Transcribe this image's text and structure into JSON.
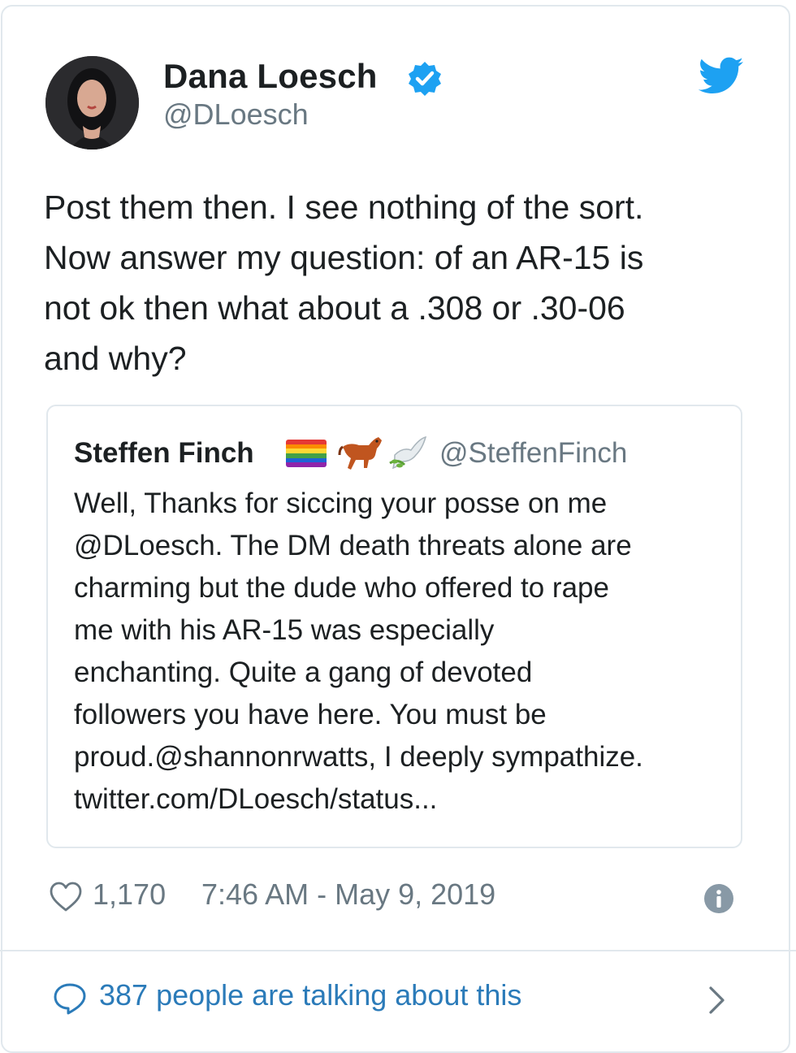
{
  "author": {
    "name": "Dana Loesch",
    "handle": "@DLoesch",
    "verified_icon": "verified-badge-icon",
    "avatar_icon": "avatar"
  },
  "platform_icon": "twitter-bird-icon",
  "tweet_text": "Post them then. I see nothing of the sort.\nNow answer my question: of an AR-15 is\nnot ok then what about a .308 or .30-06\nand why?",
  "quoted_tweet": {
    "name": "Steffen Finch",
    "emoji_icons": [
      "rainbow-flag-icon",
      "horse-icon",
      "dove-icon"
    ],
    "handle": "@SteffenFinch",
    "text": "Well, Thanks for siccing your posse on me\n@DLoesch. The DM death threats alone are\ncharming but the dude who offered to rape\nme with his AR-15 was especially\nenchanting. Quite a gang of devoted\nfollowers you have here. You must be\nproud.@shannonrwatts, I deeply sympathize.\ntwitter.com/DLoesch/status..."
  },
  "footer": {
    "likes": "1,170",
    "timestamp": "7:46 AM - May 9, 2019",
    "info_icon": "info-icon"
  },
  "conversation": {
    "label": "387 people are talking about this",
    "icon": "reply-bubble-icon"
  },
  "colors": {
    "twitter_blue": "#1da1f2",
    "link_blue": "#2b7bb9",
    "text": "#1c2022",
    "muted": "#697882",
    "border": "#e1e8ed"
  }
}
